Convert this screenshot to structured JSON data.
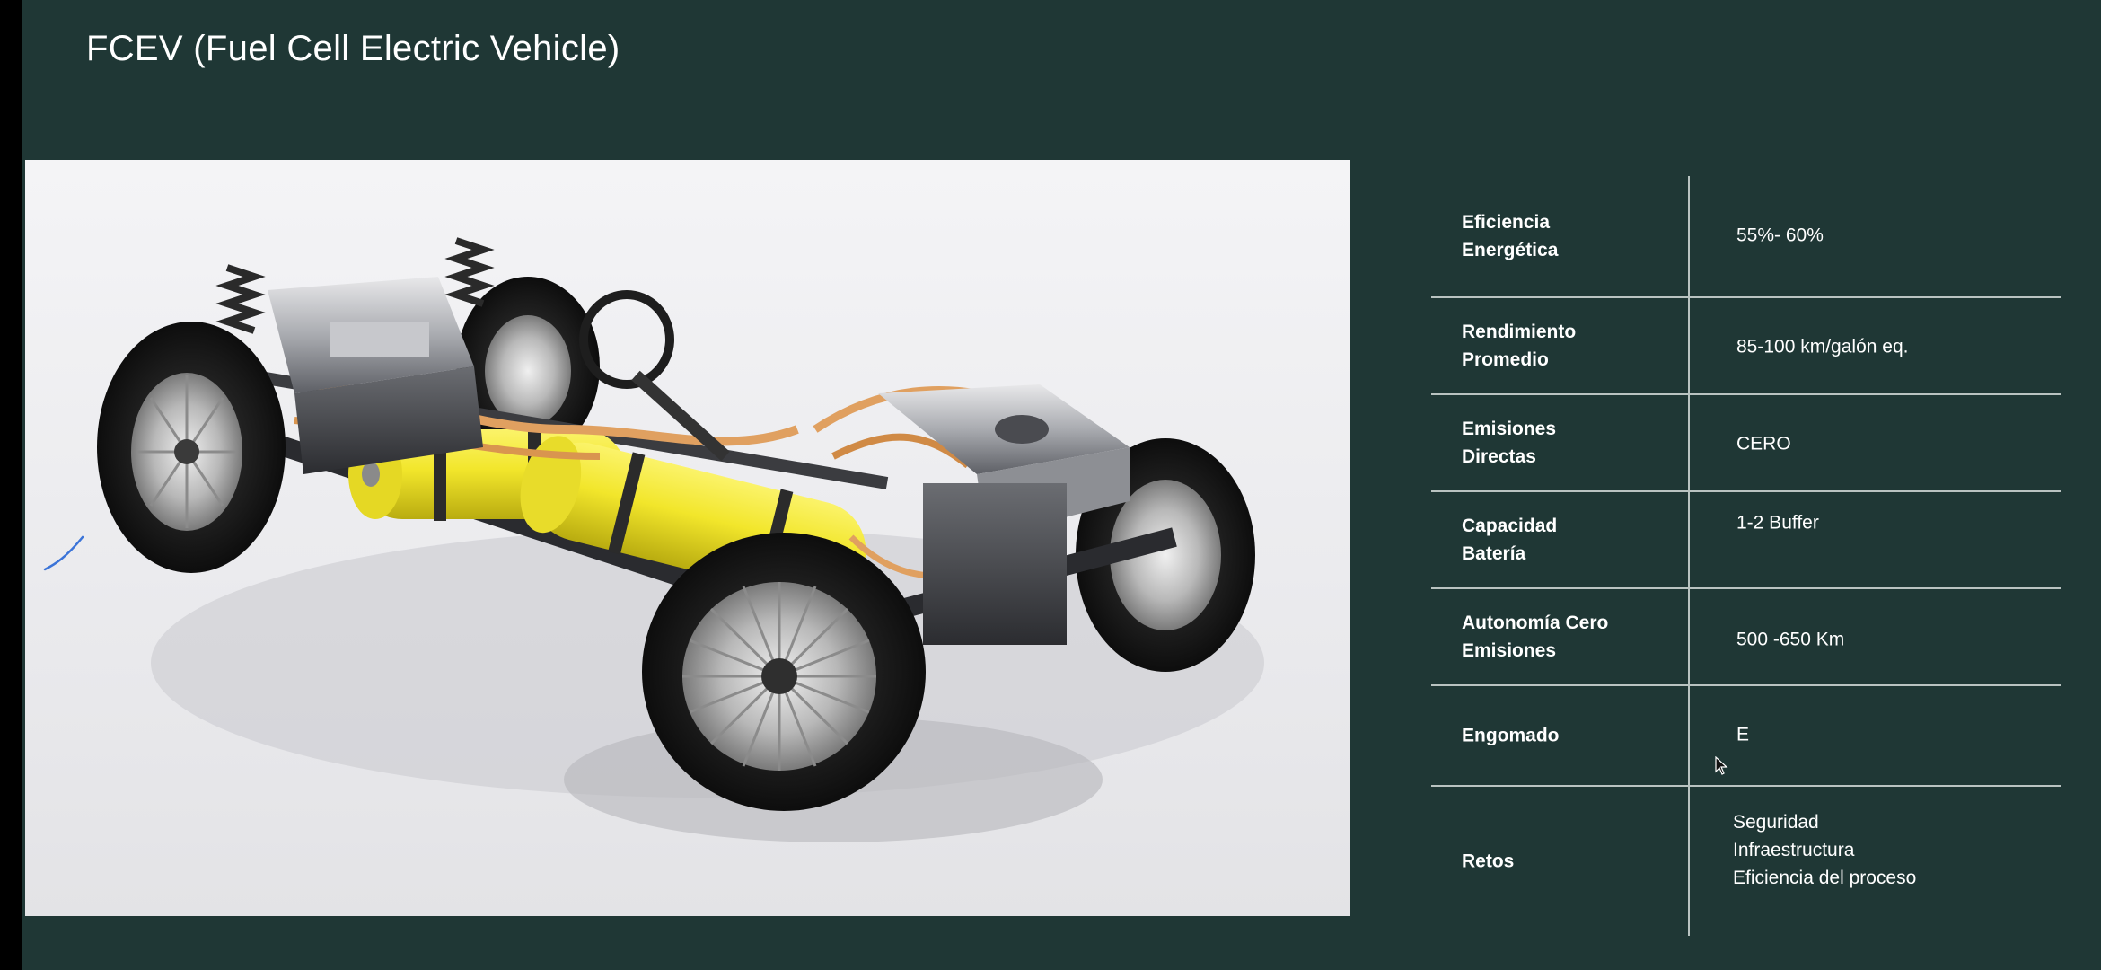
{
  "slide": {
    "title": "FCEV (Fuel Cell Electric Vehicle)"
  },
  "colors": {
    "slide_background": "#1f3735",
    "table_lines": "#b9c3c1",
    "tank_yellow": "#f2e62b",
    "wiring_orange": "#e0a060"
  },
  "image": {
    "subject": "fuel-cell-vehicle-chassis"
  },
  "specs": [
    {
      "label": "Eficiencia\nEnergética",
      "value": "55%- 60%"
    },
    {
      "label": "Rendimiento\nPromedio",
      "value": "85-100 km/galón eq."
    },
    {
      "label": "Emisiones\nDirectas",
      "value": "CERO"
    },
    {
      "label": "Capacidad\nBatería",
      "value": "1-2 Buffer"
    },
    {
      "label": "Autonomía Cero\nEmisiones",
      "value": "500 -650 Km"
    },
    {
      "label": "Engomado",
      "value": "E"
    },
    {
      "label": "Retos",
      "values": [
        "Seguridad",
        "Infraestructura",
        "Eficiencia del proceso"
      ]
    }
  ]
}
